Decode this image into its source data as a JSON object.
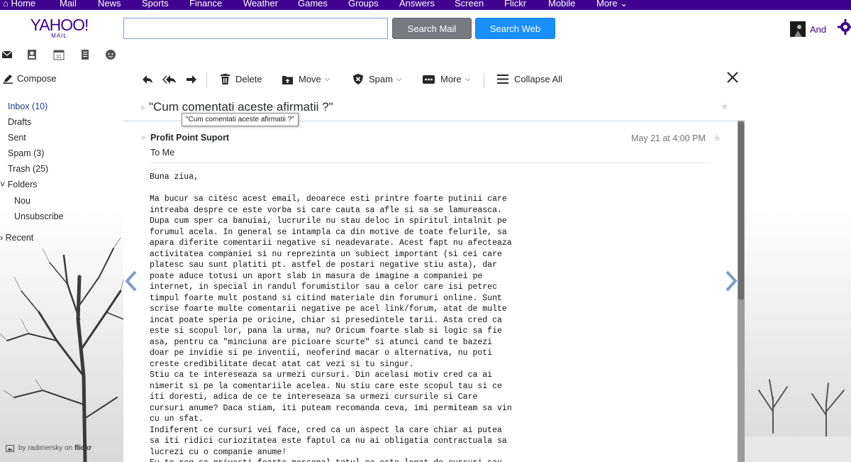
{
  "topnav": {
    "items": [
      "Home",
      "Mail",
      "News",
      "Sports",
      "Finance",
      "Weather",
      "Games",
      "Groups",
      "Answers",
      "Screen",
      "Flickr",
      "Mobile",
      "More"
    ]
  },
  "header": {
    "logo_main": "YAHOO!",
    "logo_sub": "MAIL",
    "search_placeholder": "",
    "search_mail_label": "Search Mail",
    "search_web_label": "Search Web",
    "user_name": "And"
  },
  "sidebar": {
    "compose_label": "Compose",
    "folders": [
      {
        "label": "Inbox (10)",
        "active": true
      },
      {
        "label": "Drafts"
      },
      {
        "label": "Sent"
      },
      {
        "label": "Spam (3)"
      },
      {
        "label": "Trash (25)"
      }
    ],
    "folders_toggle": "Folders",
    "custom_folders": [
      "Nou",
      "Unsubscribe"
    ],
    "recent_toggle": "Recent",
    "photo_credit_prefix": "by radimersky on",
    "photo_credit_brand": "flickr"
  },
  "toolbar": {
    "delete_label": "Delete",
    "move_label": "Move",
    "spam_label": "Spam",
    "more_label": "More",
    "collapse_label": "Collapse All"
  },
  "conversation": {
    "subject": "\"Cum comentati aceste afirmatii ?\"",
    "tooltip": "\"Cum comentati aceste afirmatii ?\""
  },
  "message": {
    "sender": "Profit Point Suport",
    "recipient": "To  Me",
    "date": "May 21 at 4:00 PM",
    "body": "Buna ziua,\n\nMa bucur sa citesc acest email, deoarece esti printre foarte putinii care\nintreaba despre ce este vorba si care cauta sa afle si sa se lamureasca.\nDupa cum sper ca banuiai, lucrurile nu stau deloc in spiritul intalnit pe\nforumul acela. In general se intampla ca din motive de toate felurile, sa\napara diferite comentarii negative si neadevarate. Acest fapt nu afecteaza\nactivitatea companiei si nu reprezinta un subiect important (si cei care\nplatesc sau sunt platiti pt. astfel de postari negative stiu asta), dar\npoate aduce totusi un aport slab in masura de imagine a companiei pe\ninternet, in special in randul forumistilor sau a celor care isi petrec\ntimpul foarte mult postand si citind materiale din forumuri online. Sunt\nscrise foarte multe comentarii negative pe acel link/forum, atat de multe\nincat poate speria pe oricine, chiar si presedintele tarii. Asta cred ca\neste si scopul lor, pana la urma, nu? Oricum foarte slab si logic sa fie\nasa, pentru ca \"minciuna are picioare scurte\" si atunci cand te bazezi\ndoar pe invidie si pe inventii, neoferind macar o alternativa, nu poti\ncreste credibilitate decat atat cat vezi si tu singur.\nStiu ca te intereseaza sa urmezi cursuri. Din acelasi motiv cred ca ai\nnimerit si pe la comentariile acelea. Nu stiu care este scopul tau si ce\niti doresti, adica de ce te intereseaza sa urmezi cursurile si Care\ncursuri anume? Daca stiam, iti puteam recomanda ceva, imi permiteam sa vin\ncu un sfat.\nIndiferent ce cursuri vei face, cred ca un aspect la care chiar ai putea\nsa iti ridici curiozitatea este faptul ca nu ai obligatia contractuala sa\nlucrezi cu o companie anume!\nEu te rog sa privesti foarte personal totul ce este legat de cursuri sau"
  },
  "colors": {
    "brand_purple": "#400090",
    "search_web_blue": "#198fff",
    "search_mail_gray": "#777b80"
  }
}
